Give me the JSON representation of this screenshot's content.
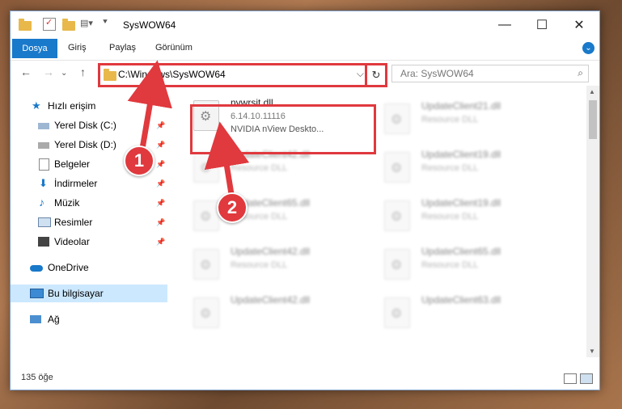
{
  "window": {
    "title": "SysWOW64",
    "minimize_icon": "—",
    "maximize_icon": "☐",
    "close_icon": "✕"
  },
  "ribbon": {
    "tabs": [
      "Dosya",
      "Giriş",
      "Paylaş",
      "Görünüm"
    ]
  },
  "address_bar": {
    "path": "C:\\Windows\\SysWOW64",
    "dropdown_glyph": "⌵",
    "refresh_glyph": "↻"
  },
  "search": {
    "placeholder": "Ara: SysWOW64"
  },
  "sidebar": {
    "items": [
      {
        "label": "Hızlı erişim"
      },
      {
        "label": "Yerel Disk (C:)"
      },
      {
        "label": "Yerel Disk (D:)"
      },
      {
        "label": "Belgeler"
      },
      {
        "label": "İndirmeler"
      },
      {
        "label": "Müzik"
      },
      {
        "label": "Resimler"
      },
      {
        "label": "Videolar"
      },
      {
        "label": "OneDrive"
      },
      {
        "label": "Bu bilgisayar"
      },
      {
        "label": "Ağ"
      }
    ]
  },
  "files": {
    "highlighted": {
      "name": "nvwrsit.dll",
      "version": "6.14.10.11116",
      "description": "NVIDIA nView Deskto..."
    },
    "items": [
      {
        "name": "UpdateClient21.dll",
        "type": "Resource DLL"
      },
      {
        "name": "UpdateClient42.dll",
        "type": "Resource DLL"
      },
      {
        "name": "UpdateClient19.dll",
        "type": "Resource DLL"
      },
      {
        "name": "UpdateClient65.dll",
        "type": "Resource DLL"
      },
      {
        "name": "UpdateClient19.dll",
        "type": "Resource DLL"
      },
      {
        "name": "UpdateClient42.dll",
        "type": "Resource DLL"
      },
      {
        "name": "UpdateClient65.dll",
        "type": "Resource DLL"
      },
      {
        "name": "UpdateClient42.dll",
        "type": "Resource DLL"
      },
      {
        "name": "UpdateClient63.dll",
        "type": "Resource DLL"
      }
    ]
  },
  "status": {
    "count": "135 öğe"
  },
  "annotations": {
    "step1": "1",
    "step2": "2",
    "accent_color": "#e0393e"
  }
}
